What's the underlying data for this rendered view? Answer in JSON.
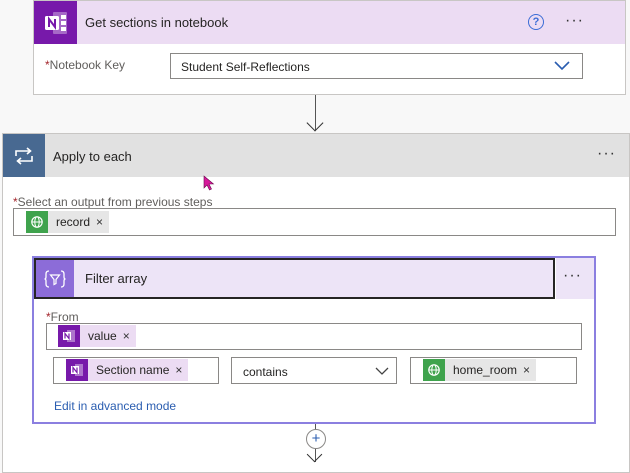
{
  "get_sections": {
    "title": "Get sections in notebook",
    "help_glyph": "?",
    "more_glyph": "···",
    "field_label": "Notebook Key",
    "required_mark": "*",
    "field_value": "Student Self-Reflections"
  },
  "apply_each": {
    "title": "Apply to each",
    "more_glyph": "···",
    "field_label": "Select an output from previous steps",
    "required_mark": "*",
    "token_label": "record",
    "token_remove": "×"
  },
  "filter_array": {
    "title": "Filter array",
    "more_glyph": "···",
    "from_label": "From",
    "required_mark": "*",
    "from_token": "value",
    "left_token": "Section name",
    "operator": "contains",
    "right_token": "home_room",
    "token_remove": "×",
    "advanced_link": "Edit in advanced mode"
  },
  "add_step_glyph": "+",
  "colors": {
    "onenote": "#7719aa",
    "onenote_header": "#ecdcf3",
    "loop": "#486991",
    "filter_tile": "#8c6cd8",
    "filter_header": "#ede4f7",
    "globe_green": "#3fa34d",
    "link": "#2a5db0"
  }
}
